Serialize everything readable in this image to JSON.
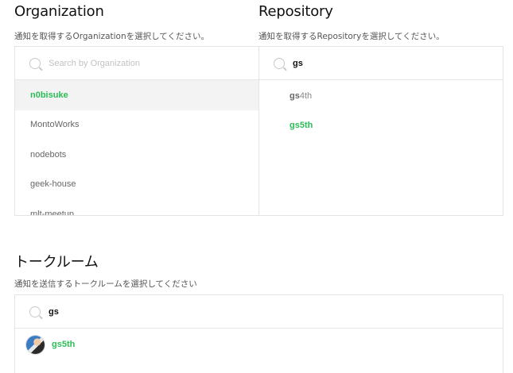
{
  "organization": {
    "title": "Organization",
    "description": "通知を取得するOrganizationを選択してください。",
    "search_placeholder": "Search by Organization",
    "search_value": "",
    "items": [
      {
        "label": "n0bisuke",
        "selected": true
      },
      {
        "label": "MontoWorks",
        "selected": false
      },
      {
        "label": "nodebots",
        "selected": false
      },
      {
        "label": "geek-house",
        "selected": false
      },
      {
        "label": "mlt-meetup",
        "selected": false
      }
    ]
  },
  "repository": {
    "title": "Repository",
    "description": "通知を取得するRepositoryを選択してください。",
    "search_value": "gs",
    "items": [
      {
        "match": "gs",
        "rest": "4th",
        "selected": false
      },
      {
        "match": "gs",
        "rest": "5th",
        "selected": true
      }
    ]
  },
  "talkroom": {
    "title": "トークルーム",
    "description": "通知を送信するトークルームを選択してください",
    "search_value": "gs",
    "items": [
      {
        "name": "gs5th",
        "avatar": "user-avatar"
      }
    ]
  },
  "colors": {
    "accent": "#2bbd56",
    "selected_bg": "#f3f3f3",
    "border": "#e4e4e4"
  }
}
